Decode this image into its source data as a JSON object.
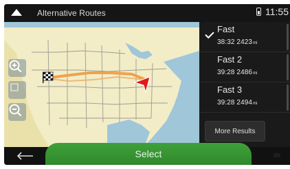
{
  "header": {
    "title": "Alternative Routes",
    "time": "11:55"
  },
  "routes": [
    {
      "name": "Fast",
      "time": "38:32",
      "distance": "2423",
      "unit": "mi",
      "selected": true
    },
    {
      "name": "Fast 2",
      "time": "39:28",
      "distance": "2486",
      "unit": "mi",
      "selected": false
    },
    {
      "name": "Fast 3",
      "time": "39:28",
      "distance": "2494",
      "unit": "mi",
      "selected": false
    }
  ],
  "more_results_label": "More Results",
  "select_label": "Select",
  "icons": {
    "header_left": "up-arrow-icon",
    "battery": "battery-icon",
    "zoom_in": "zoom-in-icon",
    "center": "center-map-icon",
    "zoom_out": "zoom-out-icon",
    "back": "back-arrow-icon",
    "destination": "checkered-flag-icon",
    "position": "navigation-arrow-icon",
    "check": "check-icon"
  },
  "colors": {
    "select_green": "#2f8a2b",
    "route_line": "#e8a54b",
    "position_arrow": "#e11919",
    "water": "#9fc6d9",
    "land": "#f3efc8"
  }
}
